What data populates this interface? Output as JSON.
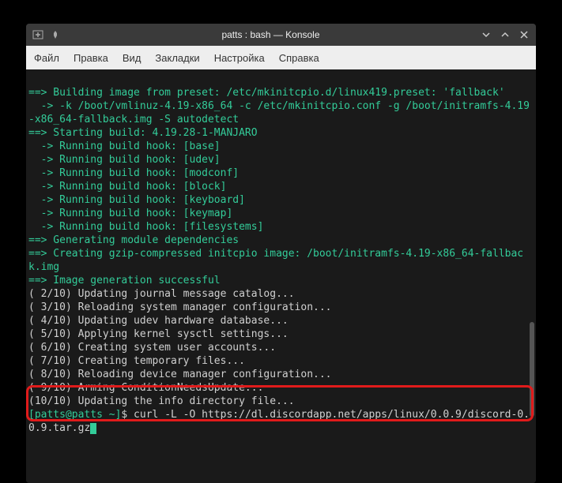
{
  "window": {
    "title": "patts : bash — Konsole"
  },
  "menu": {
    "file": "Файл",
    "edit": "Правка",
    "view": "Вид",
    "bookmarks": "Закладки",
    "settings": "Настройка",
    "help": "Справка"
  },
  "terminal": {
    "l01": "==> Building image from preset: /etc/mkinitcpio.d/linux419.preset: 'fallback'",
    "l02": "  -> -k /boot/vmlinuz-4.19-x86_64 -c /etc/mkinitcpio.conf -g /boot/initramfs-4.19-x86_64-fallback.img -S autodetect",
    "l03": "==> Starting build: 4.19.28-1-MANJARO",
    "l04": "  -> Running build hook: [base]",
    "l05": "  -> Running build hook: [udev]",
    "l06": "  -> Running build hook: [modconf]",
    "l07": "  -> Running build hook: [block]",
    "l08": "  -> Running build hook: [keyboard]",
    "l09": "  -> Running build hook: [keymap]",
    "l10": "  -> Running build hook: [filesystems]",
    "l11": "==> Generating module dependencies",
    "l12": "==> Creating gzip-compressed initcpio image: /boot/initramfs-4.19-x86_64-fallback.img",
    "l13": "==> Image generation successful",
    "l14": "( 2/10) Updating journal message catalog...",
    "l15": "( 3/10) Reloading system manager configuration...",
    "l16": "( 4/10) Updating udev hardware database...",
    "l17": "( 5/10) Applying kernel sysctl settings...",
    "l18": "( 6/10) Creating system user accounts...",
    "l19": "( 7/10) Creating temporary files...",
    "l20": "( 8/10) Reloading device manager configuration...",
    "l21": "( 9/10) Arming ConditionNeedsUpdate...",
    "l22": "(10/10) Updating the info directory file...",
    "prompt_user_host": "[patts@patts ~]",
    "prompt_symbol": "$",
    "command": " curl -L -O https://dl.discordapp.net/apps/linux/0.0.9/discord-0.0.9.tar.gz"
  }
}
